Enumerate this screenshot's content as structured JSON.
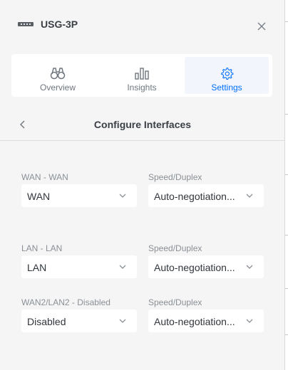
{
  "header": {
    "device_name": "USG-3P"
  },
  "tabs": [
    {
      "label": "Overview",
      "icon": "binoculars-icon"
    },
    {
      "label": "Insights",
      "icon": "bar-chart-icon"
    },
    {
      "label": "Settings",
      "icon": "gear-icon"
    }
  ],
  "subheader": {
    "title": "Configure Interfaces"
  },
  "interfaces": [
    {
      "label": "WAN - WAN",
      "value": "WAN",
      "speed_label": "Speed/Duplex",
      "speed_value": "Auto-negotiation..."
    },
    {
      "label": "LAN - LAN",
      "value": "LAN",
      "speed_label": "Speed/Duplex",
      "speed_value": "Auto-negotiation..."
    },
    {
      "label": "WAN2/LAN2 - Disabled",
      "value": "Disabled",
      "speed_label": "Speed/Duplex",
      "speed_value": "Auto-negotiation..."
    }
  ],
  "colors": {
    "accent": "#006fff",
    "panel_bg": "#f5f5f5",
    "text_dark": "#3a3f45",
    "text_muted": "#8a9096"
  }
}
